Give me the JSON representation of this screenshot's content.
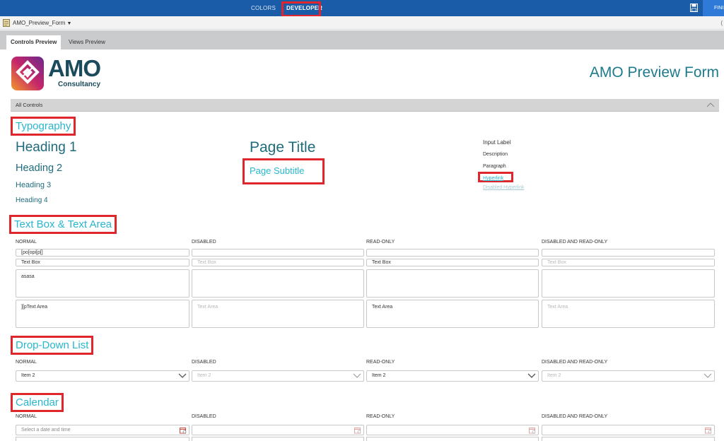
{
  "ribbon": {
    "tabs": [
      {
        "label": "COLORS",
        "active": false
      },
      {
        "label": "DEVELOPER",
        "active": true
      }
    ],
    "save_icon": "save-icon",
    "finish_label": "FINISH"
  },
  "file": {
    "name": "AMO_Preview_Form",
    "icon": "form-icon",
    "right_glyph": "("
  },
  "view_tabs": [
    {
      "label": "Controls Preview",
      "active": true
    },
    {
      "label": "Views Preview",
      "active": false
    }
  ],
  "header": {
    "logo_text": "AMO",
    "logo_subtext": "Consultancy",
    "form_title": "AMO Preview Form"
  },
  "section": {
    "label": "All Controls",
    "collapse_icon": "chevron-up-icon"
  },
  "typography": {
    "title": "Typography",
    "heading1": "Heading 1",
    "heading2": "Heading 2",
    "heading3": "Heading 3",
    "heading4": "Heading 4",
    "page_title": "Page Title",
    "page_subtitle": "Page Subtitle",
    "input_label": "Input Label",
    "description": "Description",
    "paragraph": "Paragraph",
    "hyperlink": "Hyperlink",
    "disabled_hyperlink": "Disabled Hyperlink"
  },
  "columns": [
    "NORMAL",
    "DISABLED",
    "READ-ONLY",
    "DISABLED AND READ-ONLY"
  ],
  "textbox": {
    "title": "Text Box & Text Area",
    "row1": [
      "[po[opi[p[]",
      "",
      "",
      ""
    ],
    "row2": [
      "Text Box",
      "Text Box",
      "Text Box",
      "Text Box"
    ],
    "area1": [
      "asasa",
      "",
      "",
      ""
    ],
    "area2": [
      "][pText Area",
      "Text Area",
      "Text Area",
      "Text Area"
    ]
  },
  "dropdown": {
    "title": "Drop-Down List",
    "values": [
      "Item 2",
      "Item 2",
      "Item 2",
      "Item 2"
    ]
  },
  "calendar": {
    "title": "Calendar",
    "placeholder": "Select a date and time",
    "icon": "calendar-icon"
  },
  "colors": {
    "ribbon": "#1a5ca8",
    "accent_teal": "#1e7a8c",
    "section_cyan": "#28b6cf",
    "highlight_red": "#e0262d"
  }
}
